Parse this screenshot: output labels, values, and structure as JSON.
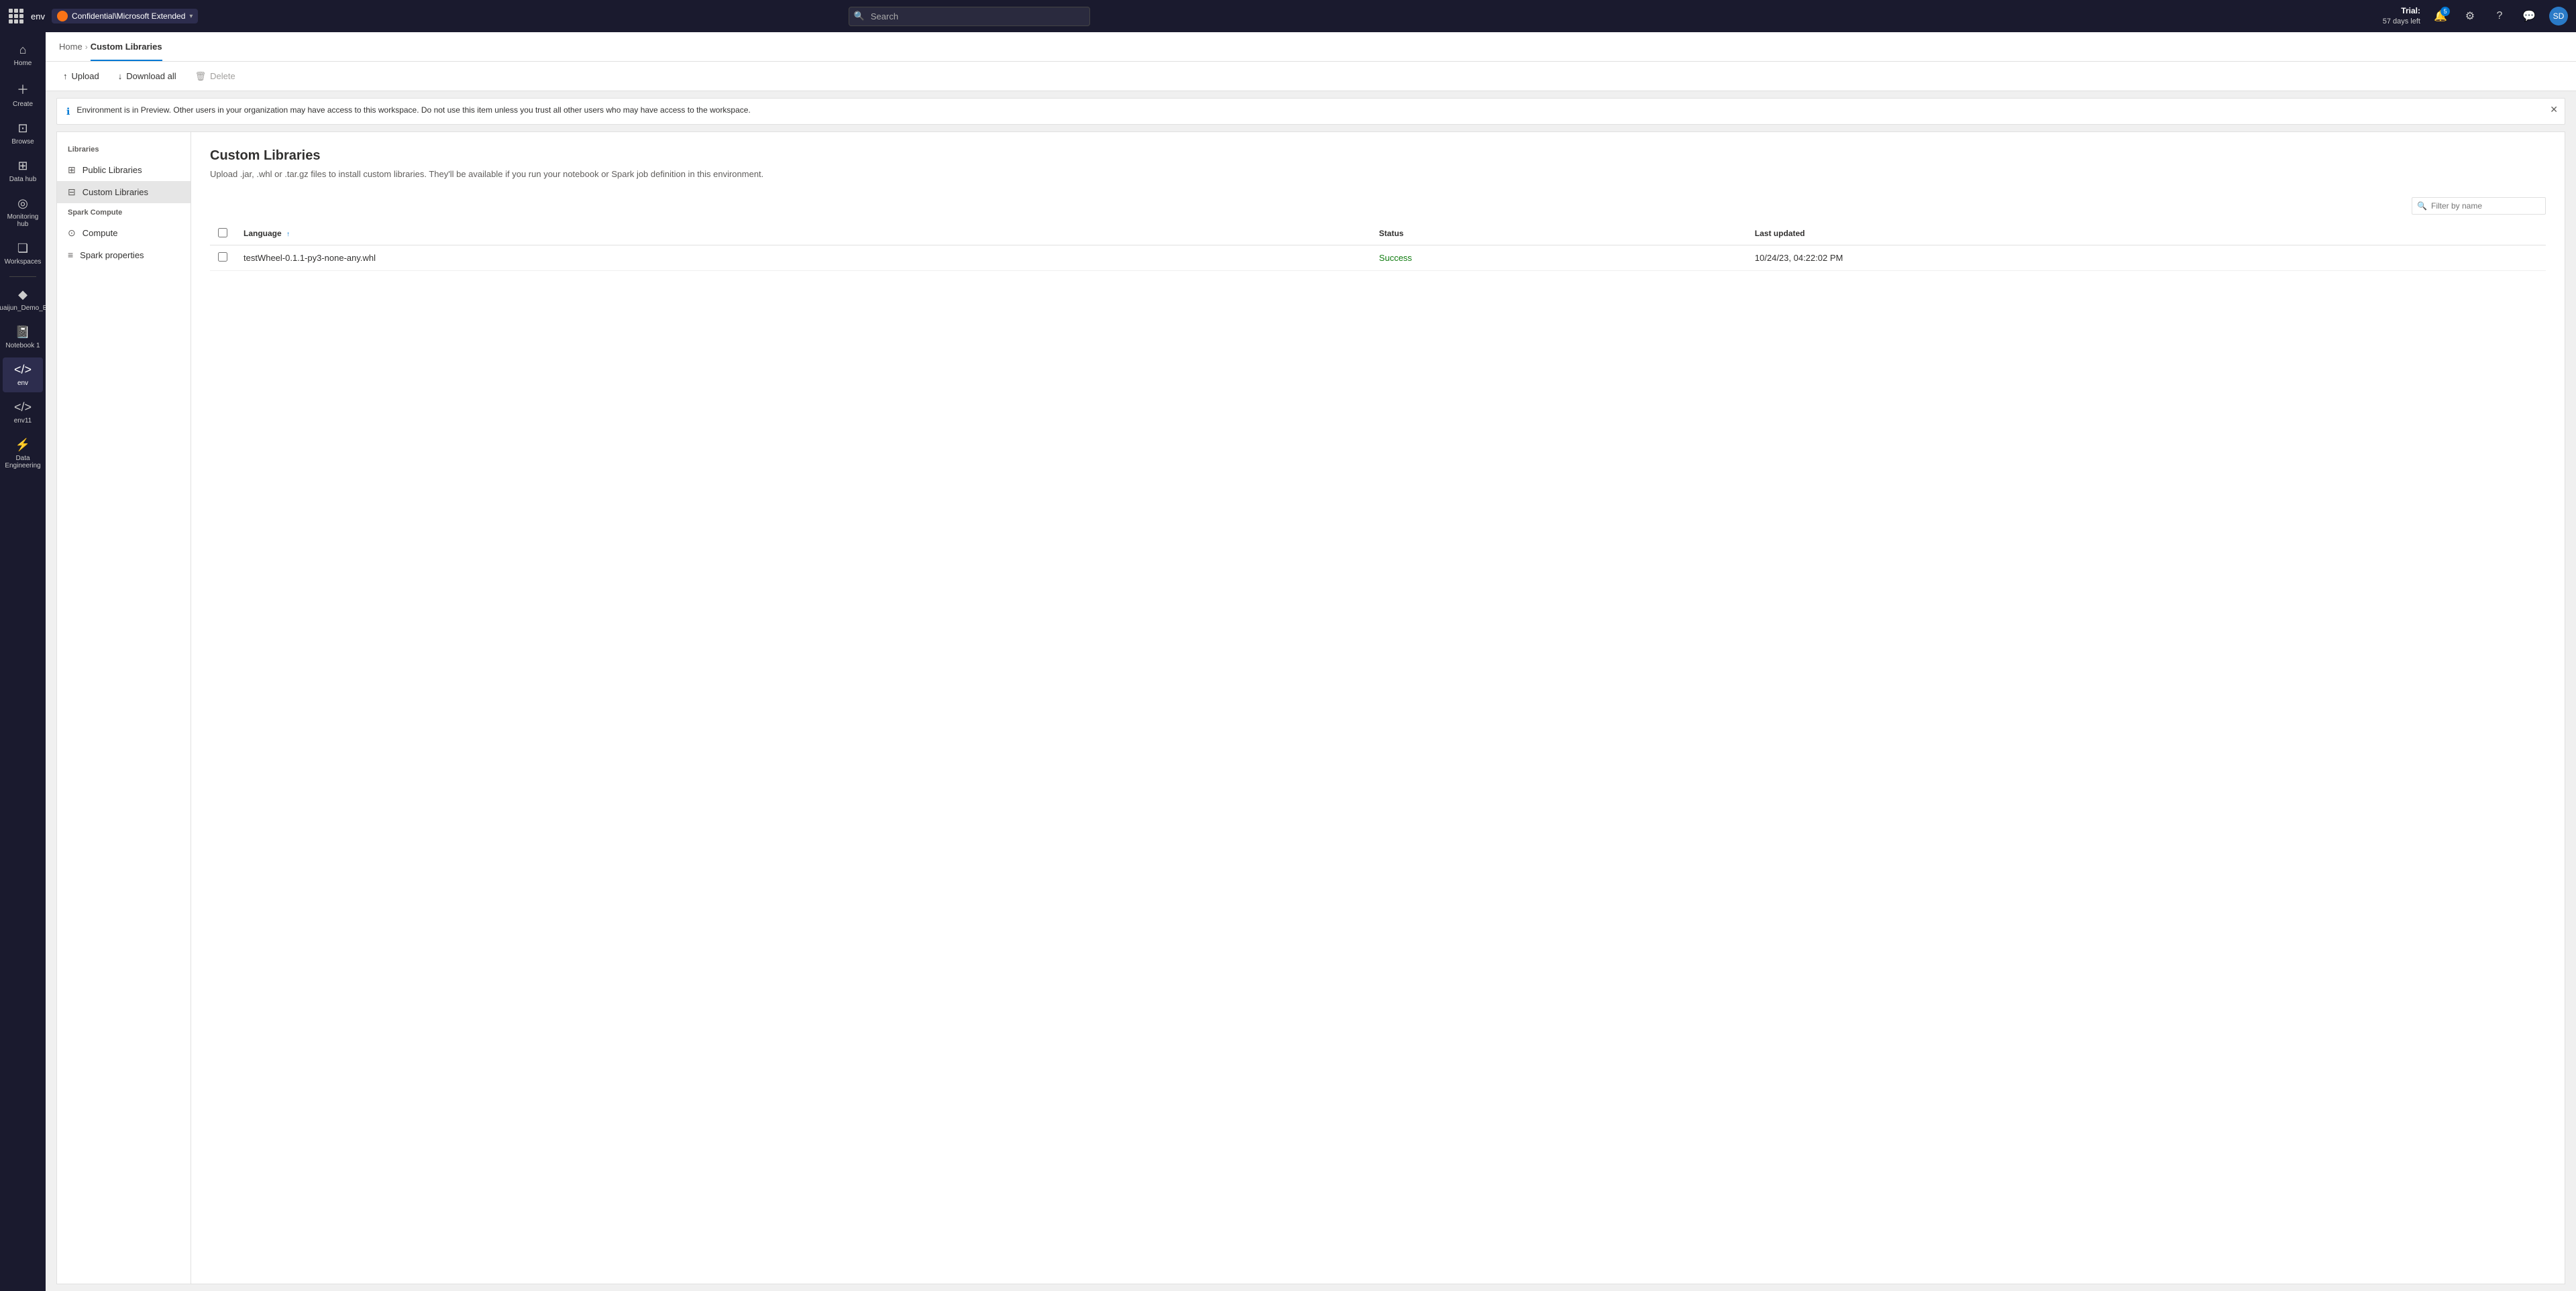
{
  "topnav": {
    "env_label": "env",
    "workspace_name": "Confidential\\Microsoft Extended",
    "search_placeholder": "Search",
    "trial_label": "Trial:",
    "trial_days": "57 days left",
    "notification_count": "5",
    "avatar_initials": "SD"
  },
  "sidebar": {
    "items": [
      {
        "id": "home",
        "label": "Home",
        "icon": "⌂"
      },
      {
        "id": "create",
        "label": "Create",
        "icon": "+"
      },
      {
        "id": "browse",
        "label": "Browse",
        "icon": "❑"
      },
      {
        "id": "datahub",
        "label": "Data hub",
        "icon": "⊞"
      },
      {
        "id": "monitoring",
        "label": "Monitoring hub",
        "icon": "◎"
      },
      {
        "id": "workspaces",
        "label": "Workspaces",
        "icon": "❏"
      },
      {
        "id": "shuaijun",
        "label": "Shuaijun_Demo_Env",
        "icon": "✦"
      },
      {
        "id": "notebook1",
        "label": "Notebook 1",
        "icon": "📓"
      },
      {
        "id": "env",
        "label": "env",
        "icon": "⟨/⟩"
      },
      {
        "id": "env11",
        "label": "env11",
        "icon": "⟨/⟩"
      },
      {
        "id": "dataeng",
        "label": "Data Engineering",
        "icon": "⚡"
      }
    ]
  },
  "breadcrumb": {
    "home_label": "Home",
    "active_label": "Custom Libraries"
  },
  "toolbar": {
    "upload_label": "Upload",
    "download_all_label": "Download all",
    "delete_label": "Delete"
  },
  "banner": {
    "message": "Environment is in Preview. Other users in your organization may have access to this workspace. Do not use this item unless you trust all other users who may have access to the workspace."
  },
  "left_nav": {
    "libraries_section": "Libraries",
    "public_libraries_label": "Public Libraries",
    "custom_libraries_label": "Custom Libraries",
    "spark_section": "Spark Compute",
    "compute_label": "Compute",
    "spark_properties_label": "Spark properties"
  },
  "main_content": {
    "title": "Custom Libraries",
    "description": "Upload .jar, .whl or .tar.gz files to install custom libraries. They'll be available if you run your notebook or Spark job definition in this environment.",
    "filter_placeholder": "Filter by name",
    "table": {
      "headers": [
        {
          "id": "language",
          "label": "Language",
          "sortable": true
        },
        {
          "id": "status",
          "label": "Status"
        },
        {
          "id": "last_updated",
          "label": "Last updated"
        }
      ],
      "rows": [
        {
          "language": "testWheel-0.1.1-py3-none-any.whl",
          "status": "Success",
          "last_updated": "10/24/23, 04:22:02 PM"
        }
      ]
    }
  }
}
